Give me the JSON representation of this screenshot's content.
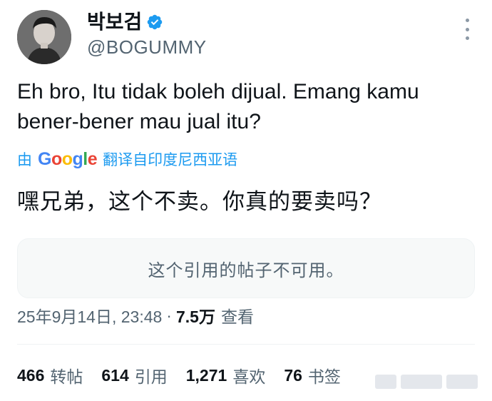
{
  "user": {
    "display_name": "박보검",
    "handle": "@BOGUMMY",
    "verified": true
  },
  "tweet": {
    "text": "Eh bro, Itu tidak boleh dijual. Emang kamu bener-bener mau jual itu?",
    "translate_prefix": "由",
    "translate_provider": "Google",
    "translate_suffix": "翻译自印度尼西亚语",
    "translated_text": "嘿兄弟，这个不卖。你真的要卖吗？",
    "quote_unavailable": "这个引用的帖子不可用。",
    "timestamp": "25年9月14日, 23:48",
    "separator": "·",
    "views_count": "7.5万",
    "views_label": "查看"
  },
  "stats": {
    "reposts": {
      "count": "466",
      "label": "转帖"
    },
    "quotes": {
      "count": "614",
      "label": "引用"
    },
    "likes": {
      "count": "1,271",
      "label": "喜欢"
    },
    "bookmarks": {
      "count": "76",
      "label": "书签"
    }
  },
  "colors": {
    "accent": "#1d9bf0",
    "text_primary": "#0f1419",
    "text_secondary": "#536471",
    "quote_bg": "#f7f9f9"
  },
  "icons": {
    "verified": "verified-badge-icon",
    "more": "more-options-icon"
  }
}
